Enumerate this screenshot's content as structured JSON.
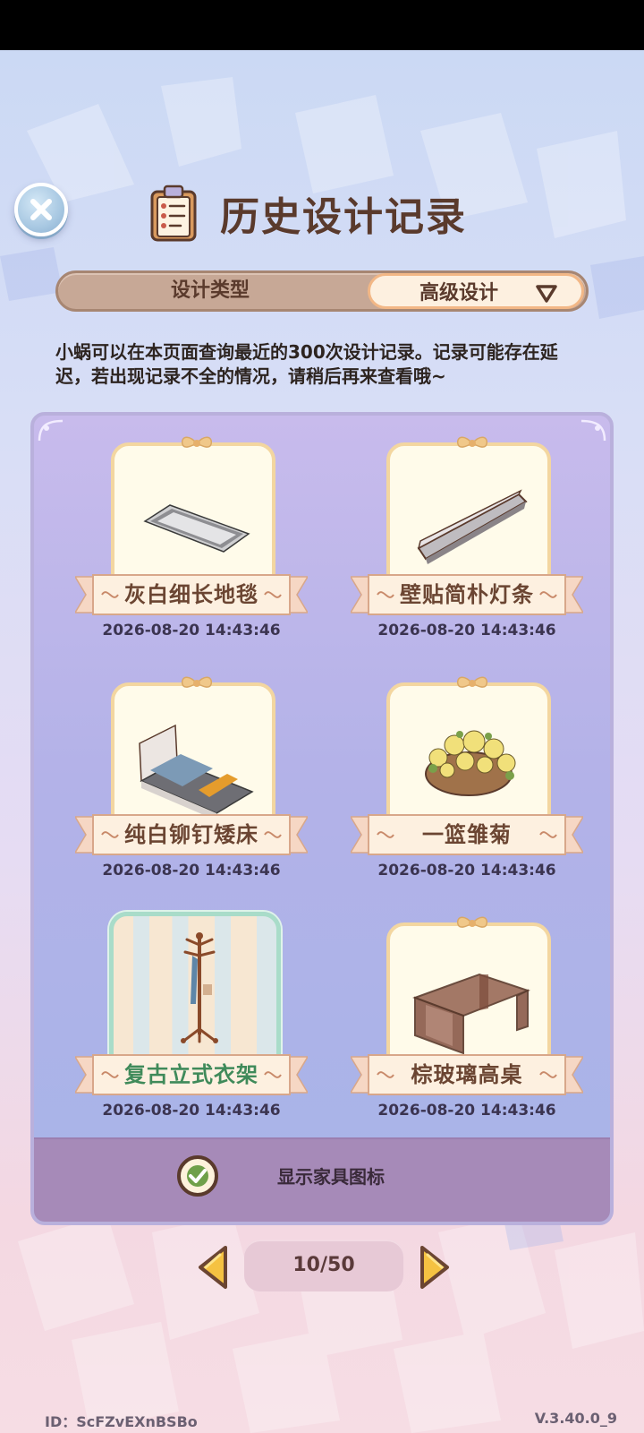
{
  "header": {
    "title": "历史设计记录"
  },
  "filter": {
    "type_label": "设计类型",
    "selected_value": "高级设计"
  },
  "notice": "小蜗可以在本页面查询最近的300次设计记录。记录可能存在延迟，若出现记录不全的情况，请稍后再来查看哦~",
  "records": [
    {
      "name": "灰白细长地毯",
      "date": "2026-08-20 14:43:46"
    },
    {
      "name": "壁贴简朴灯条",
      "date": "2026-08-20 14:43:46"
    },
    {
      "name": "纯白铆钉矮床",
      "date": "2026-08-20 14:43:46"
    },
    {
      "name": "一篮雏菊",
      "date": "2026-08-20 14:43:46"
    },
    {
      "name": "复古立式衣架",
      "date": "2026-08-20 14:43:46",
      "selected": true
    },
    {
      "name": "棕玻璃高桌",
      "date": "2026-08-20 14:43:46"
    }
  ],
  "footer": {
    "toggle_label": "显示家具图标",
    "toggle_checked": true
  },
  "pager": {
    "label": "10/50"
  },
  "meta": {
    "user_id": "ID：ScFZvEXnBSBo",
    "version": "V.3.40.0_9"
  },
  "icons": {
    "close": "close-icon",
    "title": "clipboard-icon",
    "dropdown": "triangle-down-icon",
    "check": "check-icon",
    "prev": "arrow-left-icon",
    "next": "arrow-right-icon"
  },
  "colors": {
    "accent_brown": "#5a3a2c",
    "selected_green": "#3f8a5a",
    "panel_purple": "#b3b2e8"
  }
}
